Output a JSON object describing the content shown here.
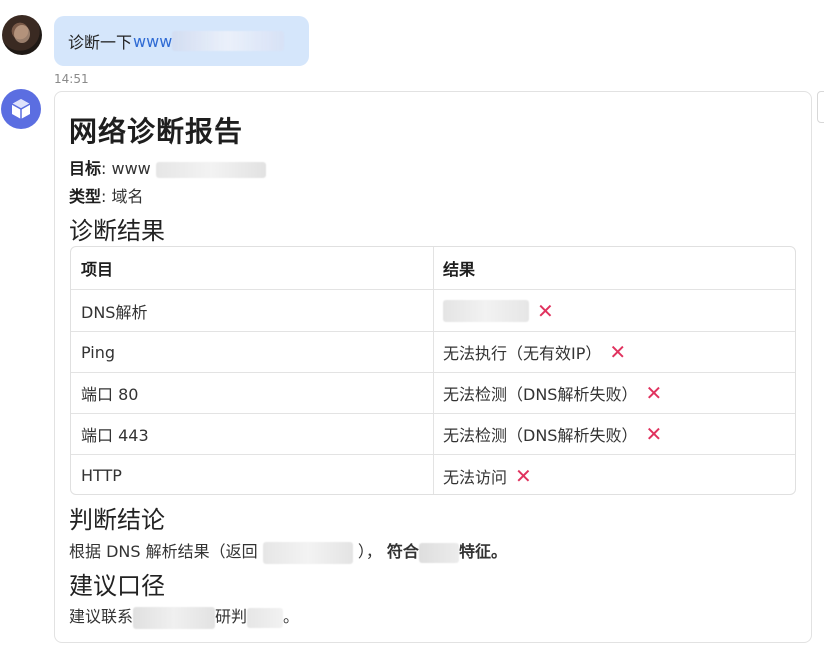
{
  "user_message": {
    "prefix": "诊断一下",
    "link": "www"
  },
  "timestamp": "14:51",
  "report": {
    "title": "网络诊断报告",
    "target_label": "目标",
    "target_value": "www",
    "type_label": "类型",
    "type_value": "域名",
    "results_heading": "诊断结果",
    "table": {
      "headers": [
        "项目",
        "结果"
      ],
      "rows": [
        {
          "item": "DNS解析",
          "result": ""
        },
        {
          "item": "Ping",
          "result": "无法执行（无有效IP）"
        },
        {
          "item": "端口 80",
          "result": "无法检测（DNS解析失败）"
        },
        {
          "item": "端口 443",
          "result": "无法检测（DNS解析失败）"
        },
        {
          "item": "HTTP",
          "result": "无法访问"
        }
      ]
    },
    "conclusion_heading": "判断结论",
    "conclusion_text_a": "根据 DNS 解析结果（返回",
    "conclusion_text_b": "），",
    "conclusion_bold_a": "符合",
    "conclusion_bold_b": "特征。",
    "advice_heading": "建议口径",
    "advice_text_a": "建议联系",
    "advice_text_b": "研判",
    "advice_text_c": "。"
  },
  "colors": {
    "user_bubble": "#d5e6fb",
    "link": "#2f6bd4",
    "fail_mark": "#e0325e",
    "bot_avatar": "#5b6ee1"
  },
  "icons": {
    "fail": "cross-mark-icon",
    "bot": "cube-icon"
  }
}
